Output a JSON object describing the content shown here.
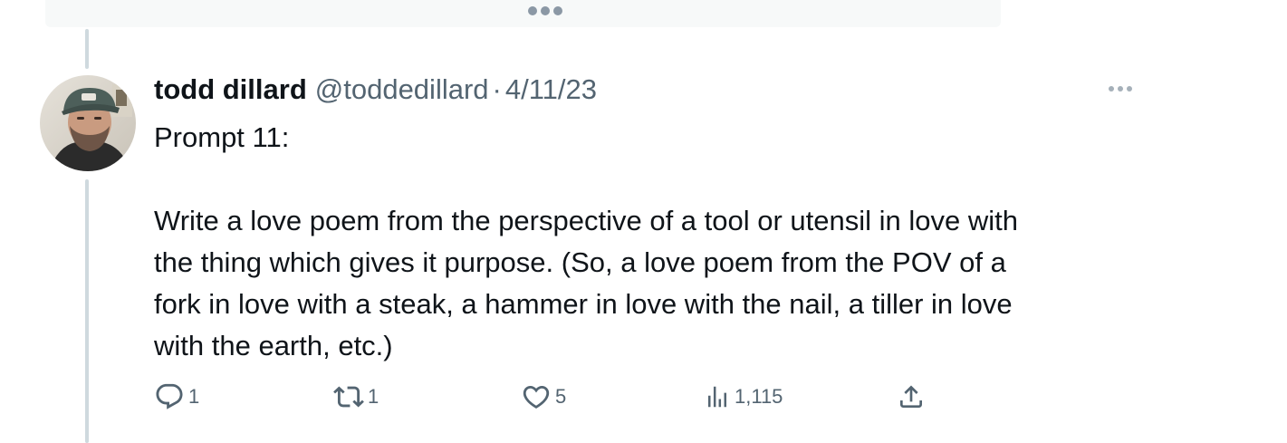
{
  "tweet": {
    "author": {
      "name": "todd dillard",
      "handle": "@toddedillard"
    },
    "separator": "·",
    "date": "4/11/23",
    "text_lines": [
      "Prompt 11:",
      "",
      "Write a love poem from the perspective of a tool or utensil in love with",
      "the thing which gives it purpose. (So, a love poem from the POV of a",
      "fork in love with a steak, a hammer in love with the nail, a tiller in love",
      "with the earth, etc.)"
    ],
    "stats": {
      "replies": "1",
      "retweets": "1",
      "likes": "5",
      "views": "1,115"
    }
  },
  "icons": {
    "reply": "reply-icon",
    "retweet": "retweet-icon",
    "like": "heart-icon",
    "views": "views-icon",
    "share": "share-icon",
    "more": "more-icon"
  },
  "colors": {
    "text_primary": "#0f1419",
    "text_secondary": "#536471",
    "thread_line": "#cfd9de"
  }
}
